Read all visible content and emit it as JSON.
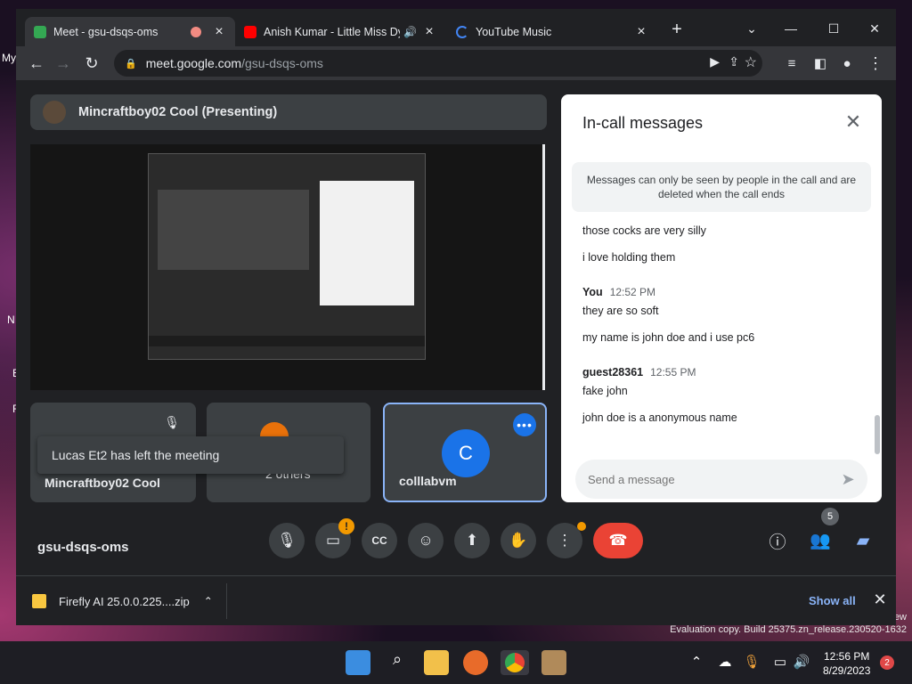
{
  "desktop": {
    "left_labels": [
      "My",
      "N",
      "E",
      "F"
    ],
    "watermark_line1": "ew",
    "watermark_line2": "Evaluation copy. Build 25375.zn_release.230520-1632"
  },
  "tabs": [
    {
      "title": "Meet - gsu-dsqs-oms",
      "favicon_color": "#34a853"
    },
    {
      "title": "Anish Kumar - Little Miss Dy",
      "favicon_color": "#ff0000"
    },
    {
      "title": "YouTube Music",
      "favicon_color": "#4285f4"
    }
  ],
  "tab_close": "×",
  "new_tab": "+",
  "window_controls": {
    "down": "⌄",
    "minimize": "—",
    "maximize": "☐",
    "close": "✕"
  },
  "address": {
    "host": "meet.google.com",
    "path": "/gsu-dsqs-oms"
  },
  "meet": {
    "presenting_label": "Mincraftboy02 Cool (Presenting)",
    "tiles": [
      {
        "name": "Mincraftboy02 Cool"
      },
      {
        "name": "2 others"
      },
      {
        "name": "colllabvm",
        "initial": "C"
      }
    ],
    "toast": "Lucas Et2 has left the meeting",
    "meeting_code": "gsu-dsqs-oms",
    "people_count": "5",
    "camera_warning": "!"
  },
  "chat": {
    "title": "In-call messages",
    "notice": "Messages can only be seen by people in the call and are deleted when the call ends",
    "messages": [
      {
        "text": "those cocks are very silly"
      },
      {
        "text": "i love holding them"
      },
      {
        "sender": "You",
        "time": "12:52 PM",
        "text": "they are so soft"
      },
      {
        "text": "my name is john doe and i use pc6"
      },
      {
        "sender": "guest28361",
        "time": "12:55 PM",
        "text": "fake john"
      },
      {
        "text": "john doe is a anonymous name"
      }
    ],
    "input_placeholder": "Send a message"
  },
  "download": {
    "file": "Firefly AI 25.0.0.225....zip",
    "show_all": "Show all"
  },
  "taskbar": {
    "time": "12:56 PM",
    "date": "8/29/2023",
    "notifications": "2"
  }
}
